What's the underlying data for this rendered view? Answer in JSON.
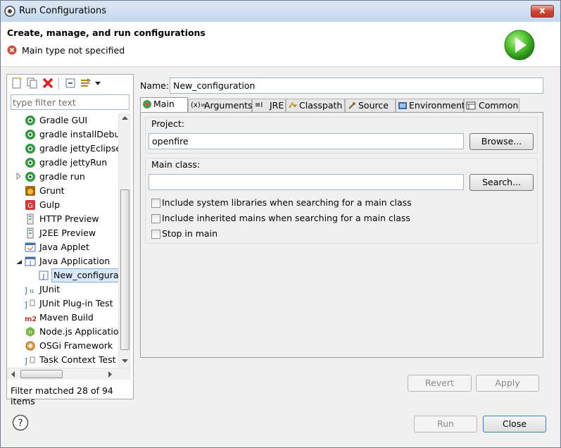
{
  "window": {
    "title": "Run Configurations",
    "close_glyph": "x"
  },
  "header": {
    "title": "Create, manage, and run configurations",
    "message": "Main type not specified"
  },
  "sidebar": {
    "filter_placeholder": "type filter text",
    "items": [
      {
        "label": "Gradle GUI",
        "icon": "gradle-icon"
      },
      {
        "label": "gradle installDebug",
        "icon": "gradle-icon"
      },
      {
        "label": "gradle jettyEclipseRun",
        "icon": "gradle-icon"
      },
      {
        "label": "gradle jettyRun",
        "icon": "gradle-icon"
      },
      {
        "label": "gradle run",
        "icon": "gradle-icon"
      },
      {
        "label": "Grunt",
        "icon": "grunt-icon"
      },
      {
        "label": "Gulp",
        "icon": "gulp-icon"
      },
      {
        "label": "HTTP Preview",
        "icon": "http-preview-icon"
      },
      {
        "label": "J2EE Preview",
        "icon": "j2ee-preview-icon"
      },
      {
        "label": "Java Applet",
        "icon": "java-applet-icon"
      },
      {
        "label": "Java Application",
        "icon": "java-application-icon"
      },
      {
        "label": "New_configuration",
        "icon": "java-class-icon"
      },
      {
        "label": "JUnit",
        "icon": "junit-icon"
      },
      {
        "label": "JUnit Plug-in Test",
        "icon": "junit-plugin-icon"
      },
      {
        "label": "Maven Build",
        "icon": "maven-icon"
      },
      {
        "label": "Node.js Application",
        "icon": "nodejs-icon"
      },
      {
        "label": "OSGi Framework",
        "icon": "osgi-icon"
      },
      {
        "label": "Task Context Test",
        "icon": "task-context-icon"
      }
    ],
    "maven_badge": "m2",
    "node_badge": "n",
    "filter_status": "Filter matched 28 of 94 items"
  },
  "config": {
    "name_label": "Name:",
    "name_value": "New_configuration",
    "tabs": [
      "Main",
      "Arguments",
      "JRE",
      "Classpath",
      "Source",
      "Environment",
      "Common"
    ],
    "tab_glyphs": [
      "(x)=",
      "≡Ι"
    ],
    "main": {
      "project_label": "Project:",
      "project_value": "openfire",
      "browse_label": "Browse...",
      "main_class_label": "Main class:",
      "main_class_value": "",
      "search_label": "Search...",
      "checkbox_include_system": "Include system libraries when searching for a main class",
      "checkbox_include_inherited": "Include inherited mains when searching for a main class",
      "checkbox_stop_in_main": "Stop in main"
    },
    "revert_label": "Revert",
    "apply_label": "Apply"
  },
  "footer": {
    "run_label": "Run",
    "close_label": "Close",
    "help_glyph": "?"
  }
}
